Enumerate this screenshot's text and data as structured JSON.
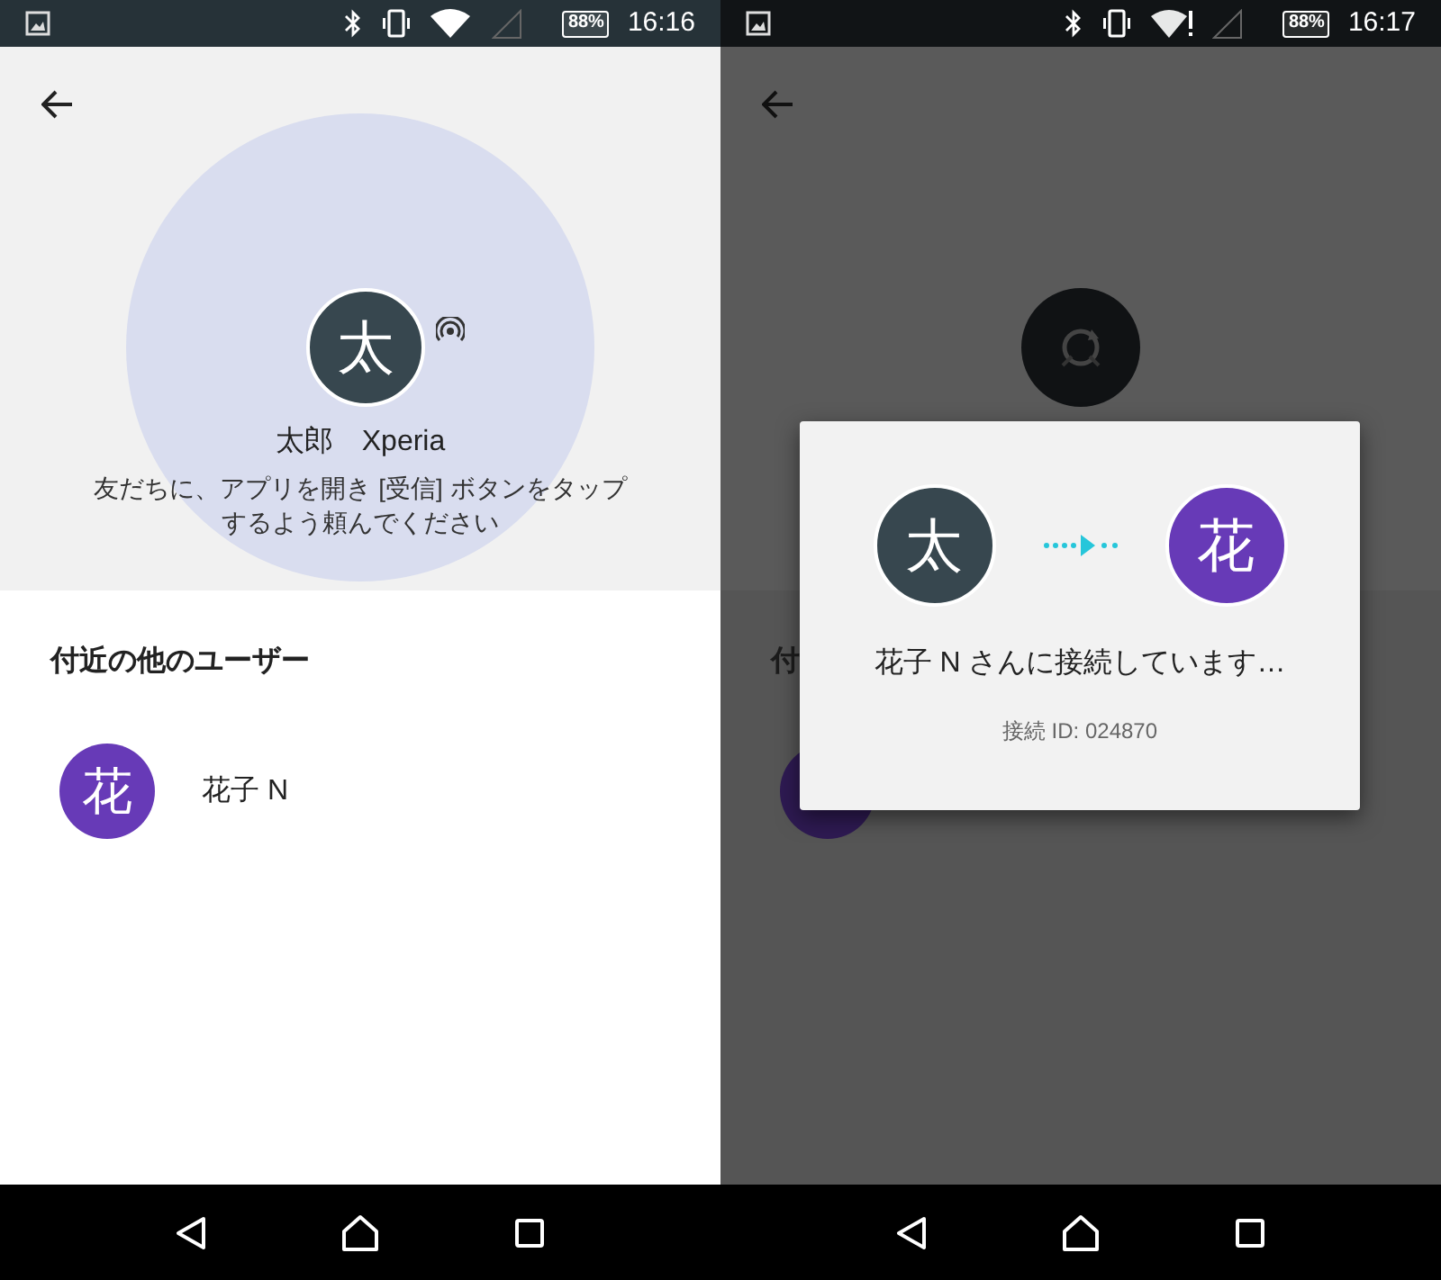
{
  "screens": [
    {
      "kind": "user",
      "status_bar": {
        "time": "16:16",
        "battery": "88%",
        "wifi_warning": false
      },
      "user": {
        "initial": "太",
        "name": "太郎　Xperia",
        "broadcasting": true
      },
      "instruction_lines": [
        "友だちに、アプリを開き [受信] ボタンをタップ",
        "するよう頼んでください"
      ],
      "section_title": "付近の他のユーザー",
      "nearby_users": [
        {
          "initial": "花",
          "name": "花子 N",
          "color": "#673ab7"
        }
      ]
    },
    {
      "kind": "connecting",
      "status_bar": {
        "time": "16:17",
        "battery": "88%",
        "wifi_warning": true
      },
      "section_title": "付",
      "nearby_users": [
        {
          "color": "#2e1a52"
        }
      ],
      "dialog": {
        "from": {
          "initial": "太",
          "color": "#37474f"
        },
        "to": {
          "initial": "花",
          "color": "#673ab7"
        },
        "message": "花子 N さんに接続しています…",
        "connection_id": "接続 ID: 024870"
      }
    }
  ]
}
